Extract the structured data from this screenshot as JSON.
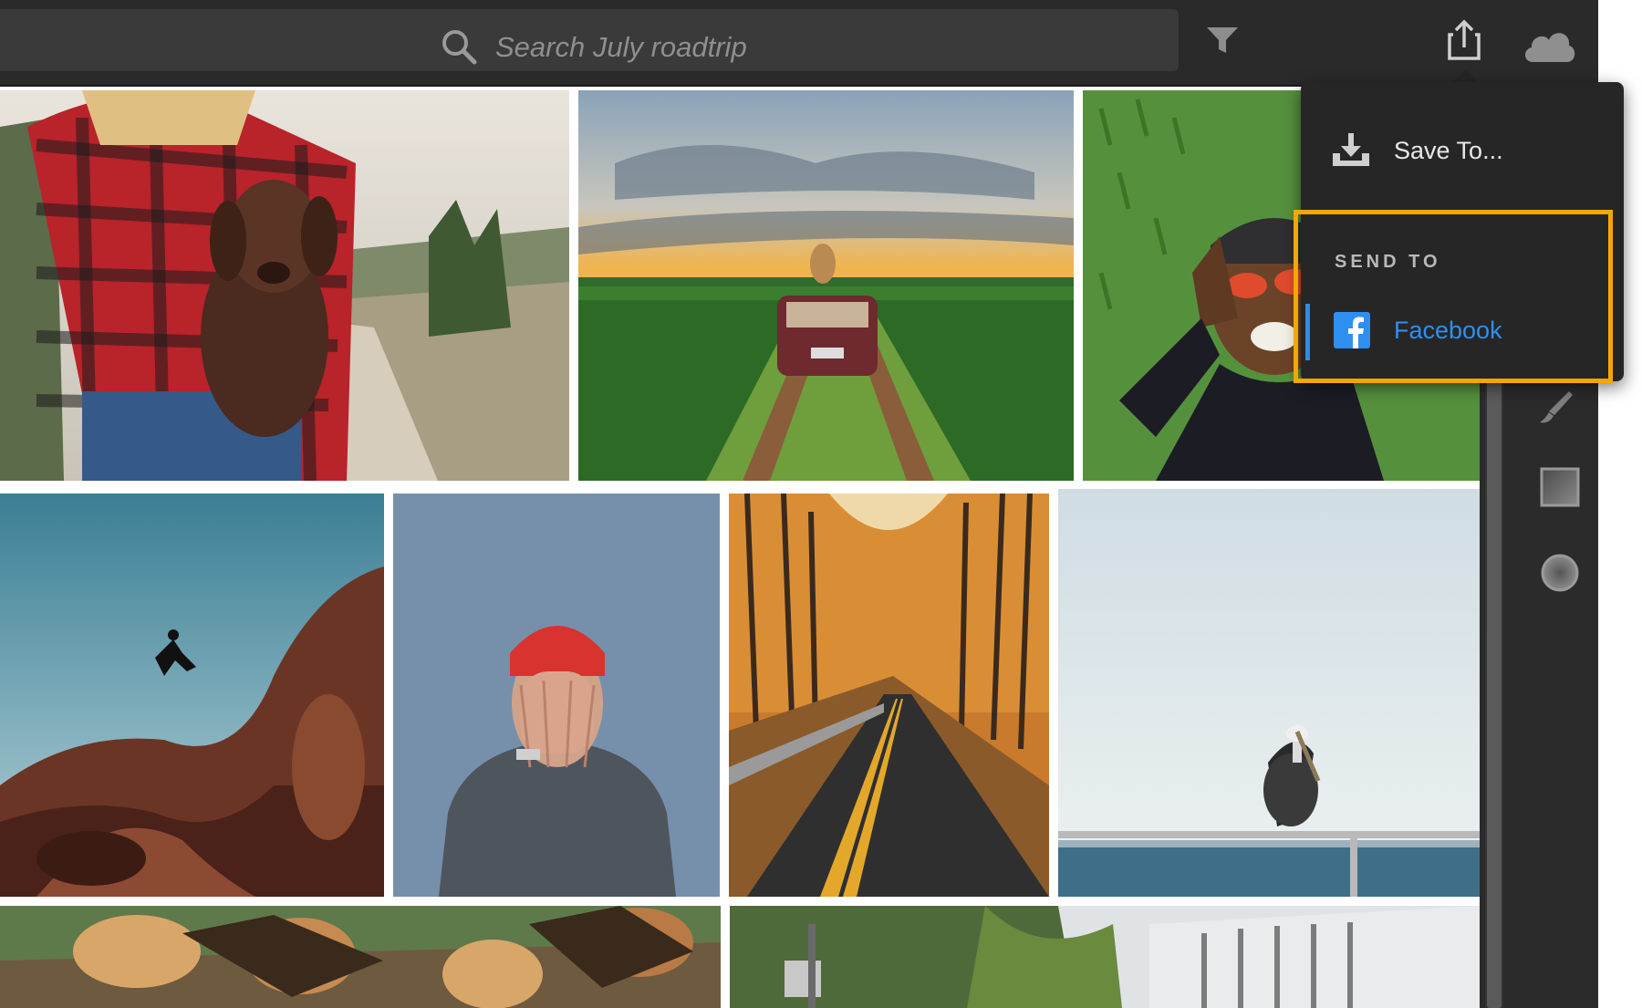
{
  "search": {
    "placeholder": "Search July roadtrip"
  },
  "toolbar": {
    "icons": [
      "search-icon",
      "filter-icon",
      "share-icon",
      "cloud-icon"
    ]
  },
  "share_menu": {
    "save_label": "Save To...",
    "send_heading": "SEND TO",
    "facebook_label": "Facebook"
  },
  "right_panel": {
    "tools": [
      "brush-icon",
      "gradient-square-icon",
      "radial-circle-icon"
    ]
  },
  "colors": {
    "accent_blue": "#2f8ff0",
    "highlight_orange": "#f5a700",
    "background": "#1f1f1f",
    "toolbar": "#2a2a2a"
  }
}
